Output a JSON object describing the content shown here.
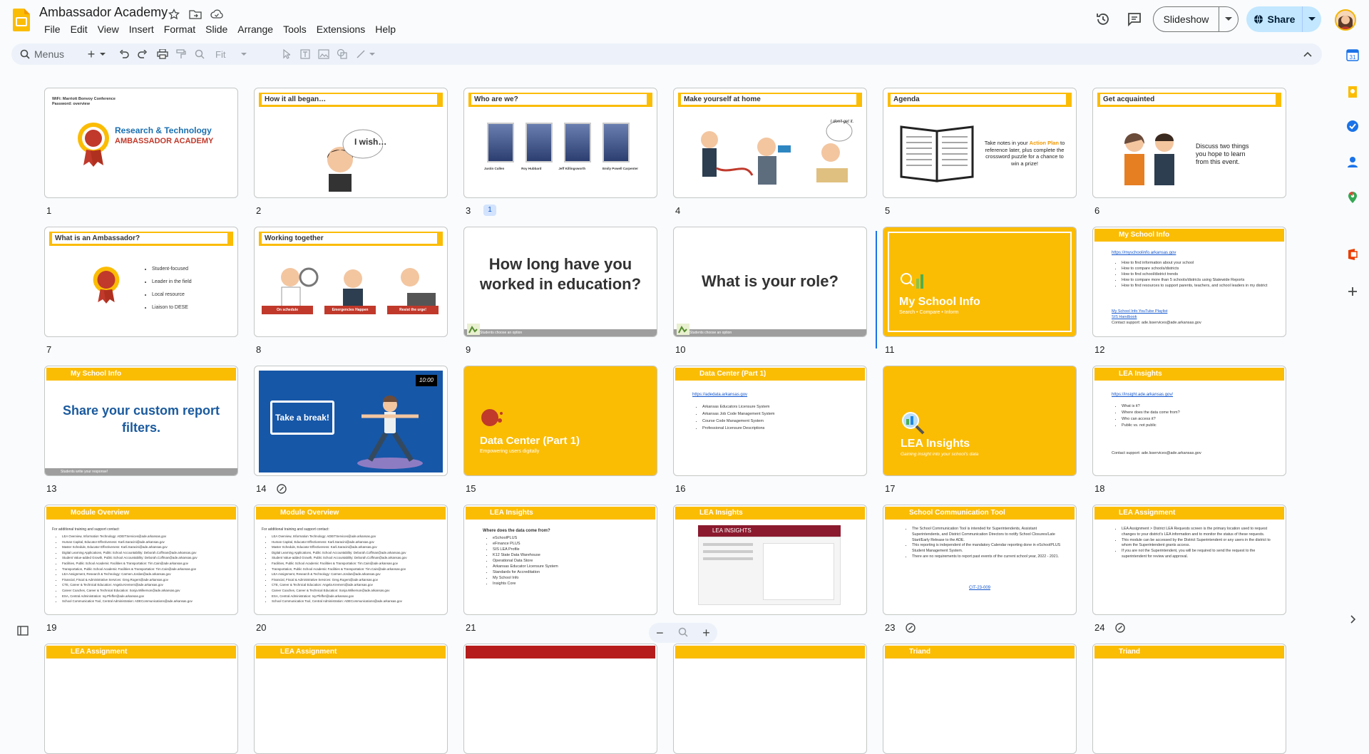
{
  "app": {
    "title": "Ambassador Academy"
  },
  "menu": [
    "File",
    "Edit",
    "View",
    "Insert",
    "Format",
    "Slide",
    "Arrange",
    "Tools",
    "Extensions",
    "Help"
  ],
  "actions": {
    "slideshow": "Slideshow",
    "share": "Share"
  },
  "toolbar": {
    "search_placeholder": "Menus",
    "zoom": "Fit"
  },
  "colors": {
    "accent": "#fbbc04",
    "share_bg": "#c2e7ff",
    "toolbar_bg": "#edf2fa",
    "link": "#1155cc"
  },
  "slides": [
    {
      "n": "1",
      "title": "Research & Technology",
      "subtitle": "AMBASSADOR ACADEMY",
      "wifi": "WiFi: Marriott Bonvoy Conference",
      "password": "Password: overview",
      "badge": "1"
    },
    {
      "n": "2",
      "title": "How it all began…",
      "bubble": "I wish…"
    },
    {
      "n": "3",
      "title": "Who are we?",
      "people": [
        "Justin Cullen",
        "Roy Hubbard",
        "Jeff Killingsworth",
        "Emily Powell Carpenter"
      ]
    },
    {
      "n": "4",
      "title": "Make yourself at home",
      "bubble": "I don't get it."
    },
    {
      "n": "5",
      "title": "Agenda",
      "text_pre": "Take notes in your ",
      "text_hl": "Action Plan",
      "text_post": " to reference later, plus complete the crossword puzzle for a chance to win a prize!"
    },
    {
      "n": "6",
      "title": "Get acquainted",
      "text": "Discuss two things you hope to learn from this event."
    },
    {
      "n": "7",
      "title": "What is an Ambassador?",
      "items": [
        "Student-focused",
        "Leader in the field",
        "Local resource",
        "Liaison to DESE"
      ]
    },
    {
      "n": "8",
      "title": "Working together",
      "labels": [
        "On schedule",
        "Emergencies Happen",
        "Resist the urge!"
      ]
    },
    {
      "n": "9",
      "question": "How long have you worked in education?",
      "footer": "Students choose an option"
    },
    {
      "n": "10",
      "question": "What is your role?",
      "footer": "Students choose an option"
    },
    {
      "n": "11",
      "title": "My School Info",
      "subtitle": "Search • Compare • Inform"
    },
    {
      "n": "12",
      "title": "My School Info",
      "link": "https://myschoolinfo.arkansas.gov",
      "items": [
        "How to find information about your school",
        "How to compare schools/districts",
        "How to find school/district trends",
        "How to compare more than 5 schools/districts using Statewide Reports",
        "How to find resources to support parents, teachers, and school leaders in my district"
      ],
      "links": [
        "My School Info YouTube Playlist",
        "SIS Handbook"
      ],
      "contact": "Contact support: ade.lsservices@ade.arkansas.gov"
    },
    {
      "n": "13",
      "title": "My School Info",
      "text": "Share your custom report filters.",
      "footer": "Students write your response!"
    },
    {
      "n": "14",
      "text": "Take a break!",
      "timer": "10:00"
    },
    {
      "n": "15",
      "title": "Data Center (Part 1)",
      "subtitle": "Empowering users digitally"
    },
    {
      "n": "16",
      "title": "Data Center (Part 1)",
      "link": "https://adedata.arkansas.gov",
      "items": [
        "Arkansas Educators Licensure System",
        "Arkansas Job Code Management System",
        "Course Code Management System",
        "Professional Licensure Descriptions"
      ]
    },
    {
      "n": "17",
      "title": "LEA Insights",
      "subtitle": "Gaining insight into your school's data"
    },
    {
      "n": "18",
      "title": "LEA Insights",
      "link": "https://insight.ade.arkansas.gov/",
      "items": [
        "What is it?",
        "Where does the data come from?",
        "Who can access it?",
        "Public vs. not public"
      ],
      "contact": "Contact support: ade.lsservices@ade.arkansas.gov"
    },
    {
      "n": "19",
      "title": "Module Overview",
      "intro": "For additional training and support contact:",
      "items": [
        "LEA Overview, Information Technology: ADEITServices@ade.arkansas.gov",
        "Human Capital, Educator Effectiveness: Karli.Saracini@ade.arkansas.gov",
        "Master Schedule, Educator Effectiveness: Karli.Saracini@ade.arkansas.gov",
        "Digital Learning Applications, Public School Accountability: Deborah.Coffman@ade.arkansas.gov",
        "Student Value-added Growth, Public School Accountability: Deborah.Coffman@ade.arkansas.gov",
        "Facilities, Public School Academic Facilities & Transportation: Tim.Cain@ade.arkansas.gov",
        "Transportation, Public School Academic Facilities & Transportation: Tim.Cain@ade.arkansas.gov",
        "LEA Assignment, Research & Technology: Carmen.Jordan@ade.arkansas.gov",
        "Financial, Fiscal & Administrative Services: Greg.Rogers@ade.arkansas.gov",
        "CTE, Career & Technical Education: Angela.Kremers@ade.arkansas.gov",
        "Career Coaches, Career & Technical Education: Sonja.Wilkerson@ade.arkansas.gov",
        "ESA, Central Administration: Ivy.Pfeffer@ade.arkansas.gov",
        "School Communication Tool, Central Administration: ADECommunications@ade.arkansas.gov"
      ]
    },
    {
      "n": "20",
      "title": "Module Overview",
      "intro": "For additional training and support contact:"
    },
    {
      "n": "21",
      "title": "LEA Insights",
      "question": "Where does the data come from?",
      "items": [
        "eSchoolPLUS",
        "eFinance PLUS",
        "SIS LEA Profile",
        "K12 State Data Warehouse",
        "Operational Data Store",
        "Arkansas Educator Licensure System",
        "Standards for Accreditation",
        "My School Info",
        "Insights Core"
      ]
    },
    {
      "n": "22",
      "title": "LEA Insights",
      "screen": "LEA INSIGHTS"
    },
    {
      "n": "23",
      "title": "School Communication Tool",
      "items": [
        "The School Communication Tool is intended for Superintendents, Assistant Superintendents, and District Communication Directors to notify School Closures/Late Start/Early Release to the ADE.",
        "This reporting is independent of the mandatory Calendar reporting done in eSchoolPLUS Student Management System.",
        "There are no requirements to report past events of the current school year, 2022 - 2021."
      ],
      "link": "CIT-23-009"
    },
    {
      "n": "24",
      "title": "LEA Assignment",
      "items": [
        "LEA Assignment > District LEA Requests screen is the primary location used to request changes to your district's LEA information and to monitor the status of these requests.",
        "This module can be accessed by the District Superintendent or any users in the district to whom the Superintendent grants access.",
        "If you are not the Superintendent, you will be required to send the request to the superintendent for review and approval."
      ]
    },
    {
      "n": "25",
      "title": "LEA Assignment"
    },
    {
      "n": "26",
      "title": "LEA Assignment"
    },
    {
      "n": "27",
      "title": ""
    },
    {
      "n": "28",
      "title": ""
    },
    {
      "n": "29",
      "title": "Triand"
    },
    {
      "n": "30",
      "title": "Triand"
    }
  ]
}
